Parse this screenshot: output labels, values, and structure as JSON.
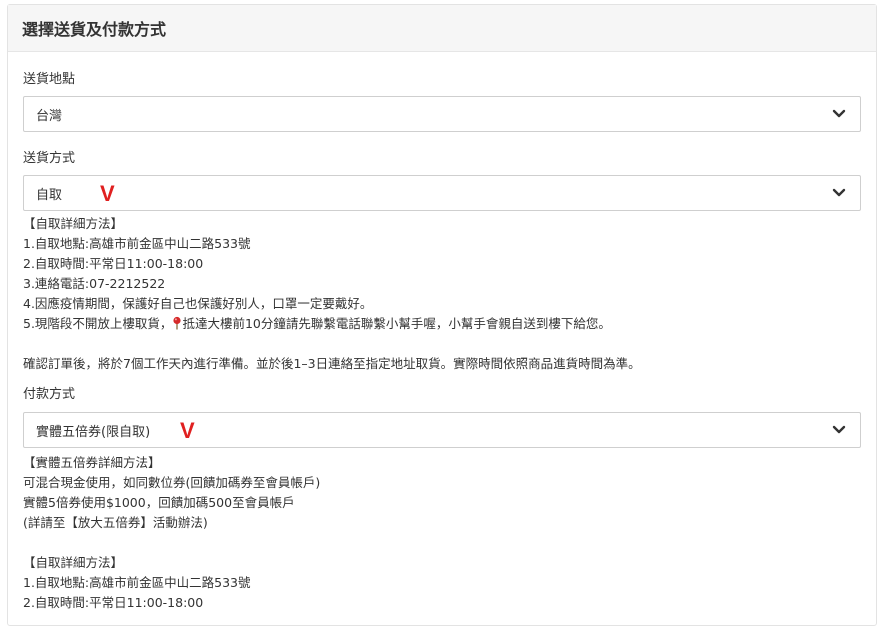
{
  "panel": {
    "title": "選擇送貨及付款方式"
  },
  "location": {
    "label": "送貨地點",
    "value": "台灣"
  },
  "shipping": {
    "label": "送貨方式",
    "value": "自取",
    "mark": "V",
    "details_lines": [
      "【自取詳細方法】",
      "1.自取地點:高雄市前金區中山二路533號",
      "2.自取時間:平常日11:00-18:00",
      "3.連絡電話:07-2212522",
      "4.因應疫情期間，保護好自己也保護好別人，口罩一定要戴好。"
    ],
    "line5_prefix": "5.現階段不開放上樓取貨，",
    "line5_suffix": "抵達大樓前10分鐘請先聯繫電話聯繫小幫手喔，小幫手會親自送到樓下給您。",
    "pin_icon": "round-pushpin-icon",
    "note": "確認訂單後，將於7個工作天內進行準備。並於後1–3日連絡至指定地址取貨。實際時間依照商品進貨時間為準。"
  },
  "payment": {
    "label": "付款方式",
    "value": "實體五倍券(限自取)",
    "mark": "V",
    "details_lines": [
      "【實體五倍券詳細方法】",
      "可混合現金使用，如同數位券(回饋加碼券至會員帳戶)",
      "實體5倍券使用$1000，回饋加碼500至會員帳戶",
      "(詳請至【放大五倍券】活動辦法)",
      "",
      "【自取詳細方法】",
      "1.自取地點:高雄市前金區中山二路533號",
      "2.自取時間:平常日11:00-18:00"
    ]
  },
  "colors": {
    "mark": "#e02020",
    "header_bg": "#f6f6f6",
    "border": "#cfcfcf"
  }
}
